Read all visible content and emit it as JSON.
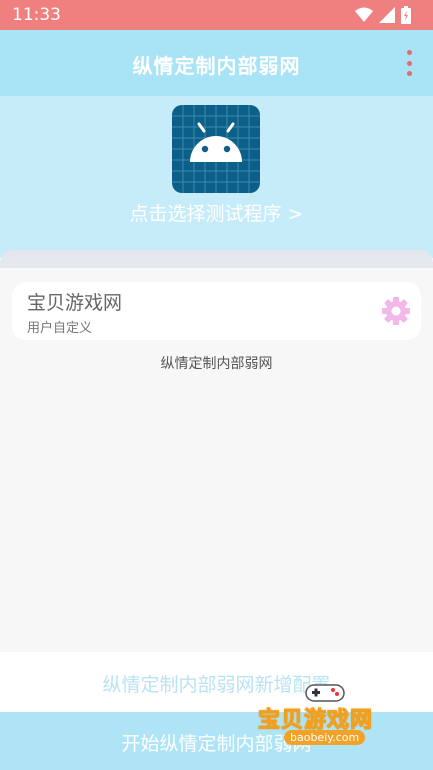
{
  "status_bar": {
    "time": "11:33"
  },
  "app_bar": {
    "title": "纵情定制内部弱网"
  },
  "hero": {
    "picker_label": "点击选择测试程序 >"
  },
  "card": {
    "name": "宝贝游戏网",
    "subtitle": "用户自定义"
  },
  "caption": "纵情定制内部弱网",
  "add_config_label": "纵情定制内部弱网新增配置",
  "start_label": "开始纵情定制内部弱网",
  "watermark": {
    "title": "宝贝游戏网",
    "url": "baobeiy.com"
  },
  "colors": {
    "status_bar": "#f08080",
    "app_bar": "#a9e3f6",
    "hero": "#c7ecf9",
    "gear": "#f3b8ea",
    "start": "#aee4f6"
  }
}
